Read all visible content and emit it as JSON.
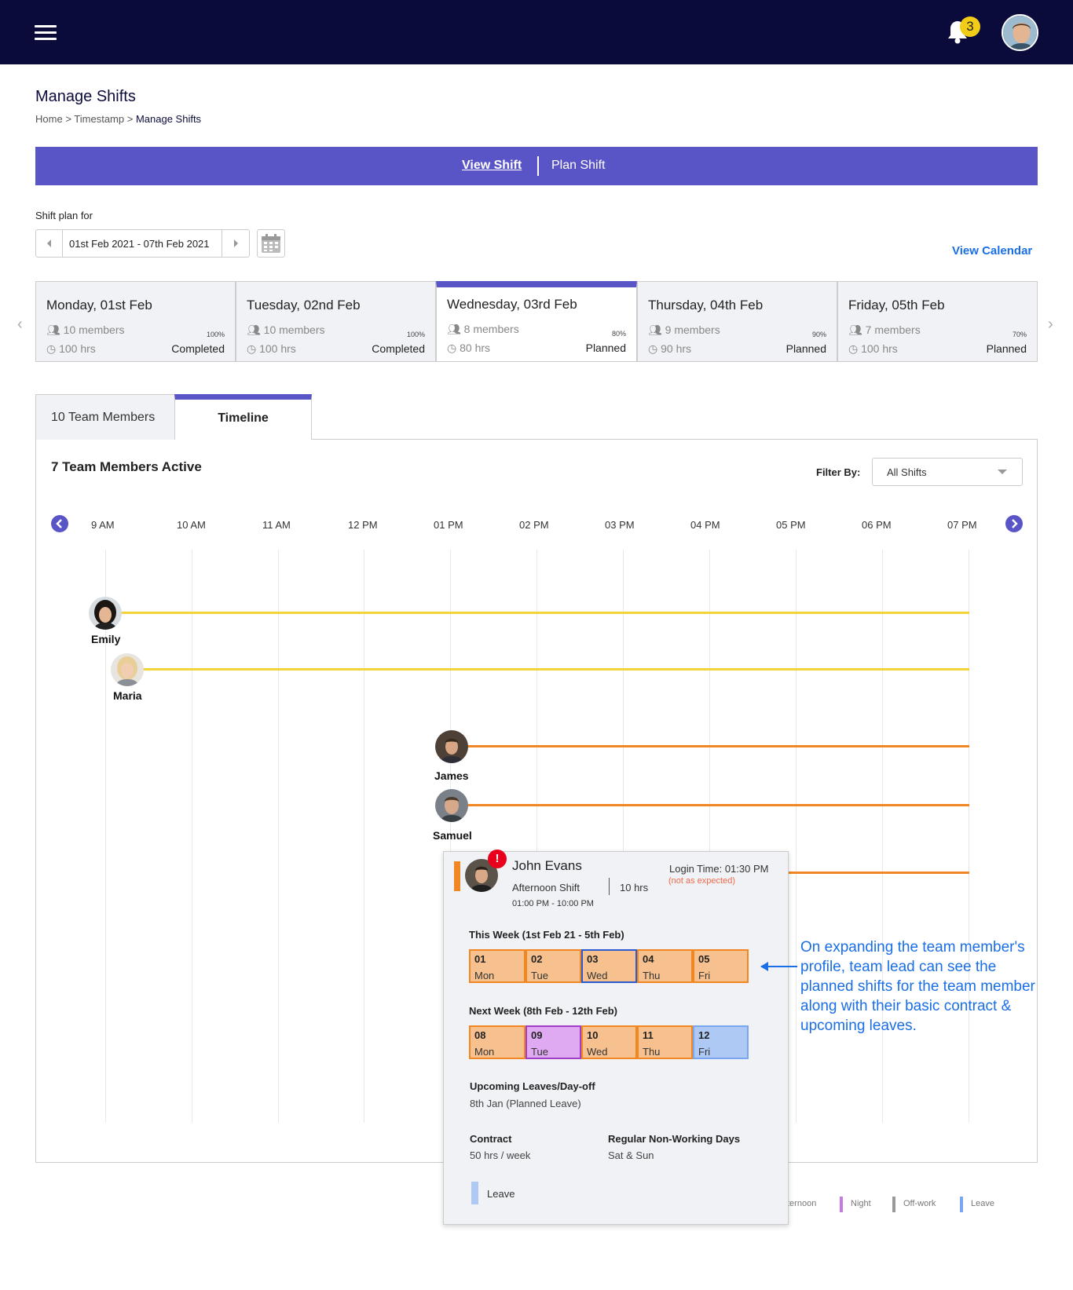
{
  "header": {
    "notification_count": "3",
    "icons": [
      "menu-icon",
      "bell-icon",
      "avatar"
    ]
  },
  "page": {
    "title": "Manage Shifts",
    "breadcrumb": [
      "Home",
      "Timestamp",
      "Manage Shifts"
    ],
    "breadcrumb_sep": ">"
  },
  "tabs_top": {
    "view": "View Shift",
    "plan": "Plan Shift"
  },
  "shift_plan": {
    "label": "Shift plan for",
    "range": "01st Feb 2021 - 07th Feb 2021",
    "view_calendar": "View Calendar"
  },
  "days": [
    {
      "name": "Monday, 01st Feb",
      "members": "10 members",
      "hrs": "100 hrs",
      "pct": "100%",
      "status": "Completed"
    },
    {
      "name": "Tuesday, 02nd Feb",
      "members": "10 members",
      "hrs": "100 hrs",
      "pct": "100%",
      "status": "Completed"
    },
    {
      "name": "Wednesday, 03rd Feb",
      "members": "8 members",
      "hrs": "80 hrs",
      "pct": "80%",
      "status": "Planned"
    },
    {
      "name": "Thursday, 04th Feb",
      "members": "9 members",
      "hrs": "90 hrs",
      "pct": "90%",
      "status": "Planned"
    },
    {
      "name": "Friday, 05th Feb",
      "members": "7 members",
      "hrs": "100 hrs",
      "pct": "70%",
      "status": "Planned"
    }
  ],
  "tabs_lower": {
    "team": "10 Team Members",
    "timeline": "Timeline"
  },
  "timeline": {
    "active_count": "7 Team Members Active",
    "filter_label": "Filter By:",
    "filter_value": "All Shifts",
    "hours": [
      "9 AM",
      "10 AM",
      "11 AM",
      "12 PM",
      "01 PM",
      "02 PM",
      "03 PM",
      "04 PM",
      "05 PM",
      "06 PM",
      "07 PM"
    ],
    "members": [
      {
        "name": "Emily",
        "start": "9 AM",
        "end": "07 PM",
        "shift": "yellow"
      },
      {
        "name": "Maria",
        "start": "9 AM",
        "end": "07 PM",
        "shift": "yellow"
      },
      {
        "name": "James",
        "start": "01 PM",
        "end": "07 PM",
        "shift": "orange"
      },
      {
        "name": "Samuel",
        "start": "01 PM",
        "end": "07 PM",
        "shift": "orange"
      }
    ]
  },
  "popup": {
    "name": "John Evans",
    "alert": "!",
    "shift": "Afternoon Shift",
    "hours": "10 hrs",
    "time": "01:00 PM - 10:00 PM",
    "login": "Login Time: 01:30 PM",
    "not_expected": "(not as expected)",
    "this_week_label": "This Week (1st Feb 21 - 5th Feb)",
    "this_week": [
      {
        "n": "01",
        "d": "Mon",
        "type": "afternoon"
      },
      {
        "n": "02",
        "d": "Tue",
        "type": "afternoon"
      },
      {
        "n": "03",
        "d": "Wed",
        "type": "today"
      },
      {
        "n": "04",
        "d": "Thu",
        "type": "afternoon"
      },
      {
        "n": "05",
        "d": "Fri",
        "type": "afternoon"
      }
    ],
    "next_week_label": "Next Week (8th Feb - 12th Feb)",
    "next_week": [
      {
        "n": "08",
        "d": "Mon",
        "type": "afternoon"
      },
      {
        "n": "09",
        "d": "Tue",
        "type": "night"
      },
      {
        "n": "10",
        "d": "Wed",
        "type": "afternoon"
      },
      {
        "n": "11",
        "d": "Thu",
        "type": "afternoon"
      },
      {
        "n": "12",
        "d": "Fri",
        "type": "leave"
      }
    ],
    "leaves_label": "Upcoming Leaves/Day-off",
    "leaves_value": "8th Jan (Planned Leave)",
    "contract_label": "Contract",
    "contract_value": "50 hrs / week",
    "nonwork_label": "Regular Non-Working Days",
    "nonwork_value": "Sat & Sun",
    "legend_leave": "Leave"
  },
  "legend": {
    "afternoon": "ternoon",
    "night": "Night",
    "offwork": "Off-work",
    "leave": "Leave"
  },
  "annotation": "On expanding the team member's profile, team lead can see the planned shifts for the team member along with their basic contract & upcoming leaves.",
  "colors": {
    "header_bg": "#0b0b3b",
    "accent": "#5a55c7",
    "link": "#1a6ee6",
    "day_shift": "#f2d43a",
    "afternoon_shift": "#f08722",
    "night": "#a13ec9",
    "offwork": "#999999",
    "leave": "#7aa6ef"
  }
}
